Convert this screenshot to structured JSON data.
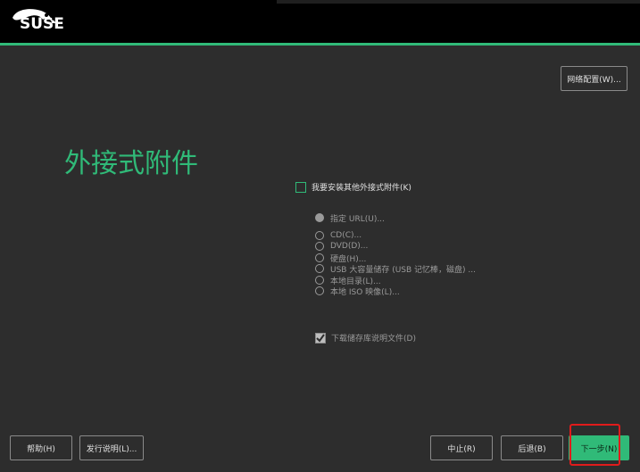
{
  "header": {
    "logo_text": "SUSE",
    "logo_icon": "suse-chameleon-icon",
    "accent_color": "#30ba78"
  },
  "network_config_label": "网络配置(W)...",
  "page_title": "外接式附件",
  "install_addon_label": "我要安装其他外接式附件(K)",
  "sources": [
    {
      "label": "指定 URL(U)...",
      "selected": true
    },
    {
      "label": "CD(C)...",
      "selected": false
    },
    {
      "label": "DVD(D)...",
      "selected": false
    },
    {
      "label": "硬盘(H)...",
      "selected": false
    },
    {
      "label": "USB 大容量储存 (USB 记忆棒，磁盘) ...",
      "selected": false
    },
    {
      "label": "本地目录(L)...",
      "selected": false
    },
    {
      "label": "本地 ISO 映像(L)...",
      "selected": false
    }
  ],
  "download_repo_desc_label": "下载储存库说明文件(D)",
  "footer": {
    "help_label": "帮助(H)",
    "release_notes_label": "发行说明(L)...",
    "abort_label": "中止(R)",
    "back_label": "后退(B)",
    "next_label": "下一步(N)"
  }
}
